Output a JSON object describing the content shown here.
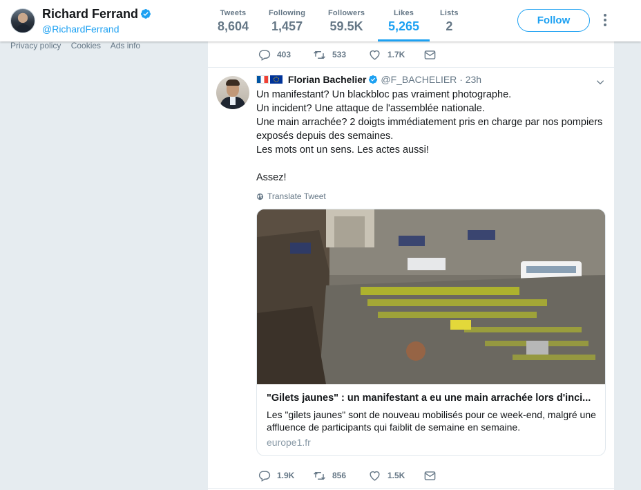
{
  "profile": {
    "name": "Richard Ferrand",
    "handle": "@RichardFerrand",
    "stats": [
      {
        "label": "Tweets",
        "value": "8,604"
      },
      {
        "label": "Following",
        "value": "1,457"
      },
      {
        "label": "Followers",
        "value": "59.5K"
      },
      {
        "label": "Likes",
        "value": "5,265"
      },
      {
        "label": "Lists",
        "value": "2"
      }
    ],
    "follow_label": "Follow"
  },
  "footer": {
    "links": [
      "Privacy policy",
      "Cookies",
      "Ads info"
    ]
  },
  "previous_tweet_actions": {
    "replies": "403",
    "retweets": "533",
    "likes": "1.7K"
  },
  "tweet": {
    "author": "Florian Bachelier",
    "handle": "@F_BACHELIER",
    "time": "· 23h",
    "lines": [
      "Un manifestant? Un blackbloc pas vraiment photographe.",
      "Un incident? Une attaque de l'assemblée nationale.",
      "Une main arrachée? 2 doigts immédiatement pris en charge par nos pompiers exposés depuis des semaines.",
      "Les mots ont un sens. Les actes aussi!",
      "",
      "Assez!"
    ],
    "translate_label": "Translate Tweet",
    "card": {
      "title": "\"Gilets jaunes\" : un manifestant a eu une main arrachée lors d'inci...",
      "description": "Les \"gilets jaunes\" sont de nouveau mobilisés pour ce week-end, malgré une affluence de participants qui faiblit de semaine en semaine.",
      "domain": "europe1.fr"
    },
    "actions": {
      "replies": "1.9K",
      "retweets": "856",
      "likes": "1.5K"
    }
  },
  "colors": {
    "accent": "#1da1f2",
    "muted": "#657786",
    "background": "#e6ecf0"
  }
}
